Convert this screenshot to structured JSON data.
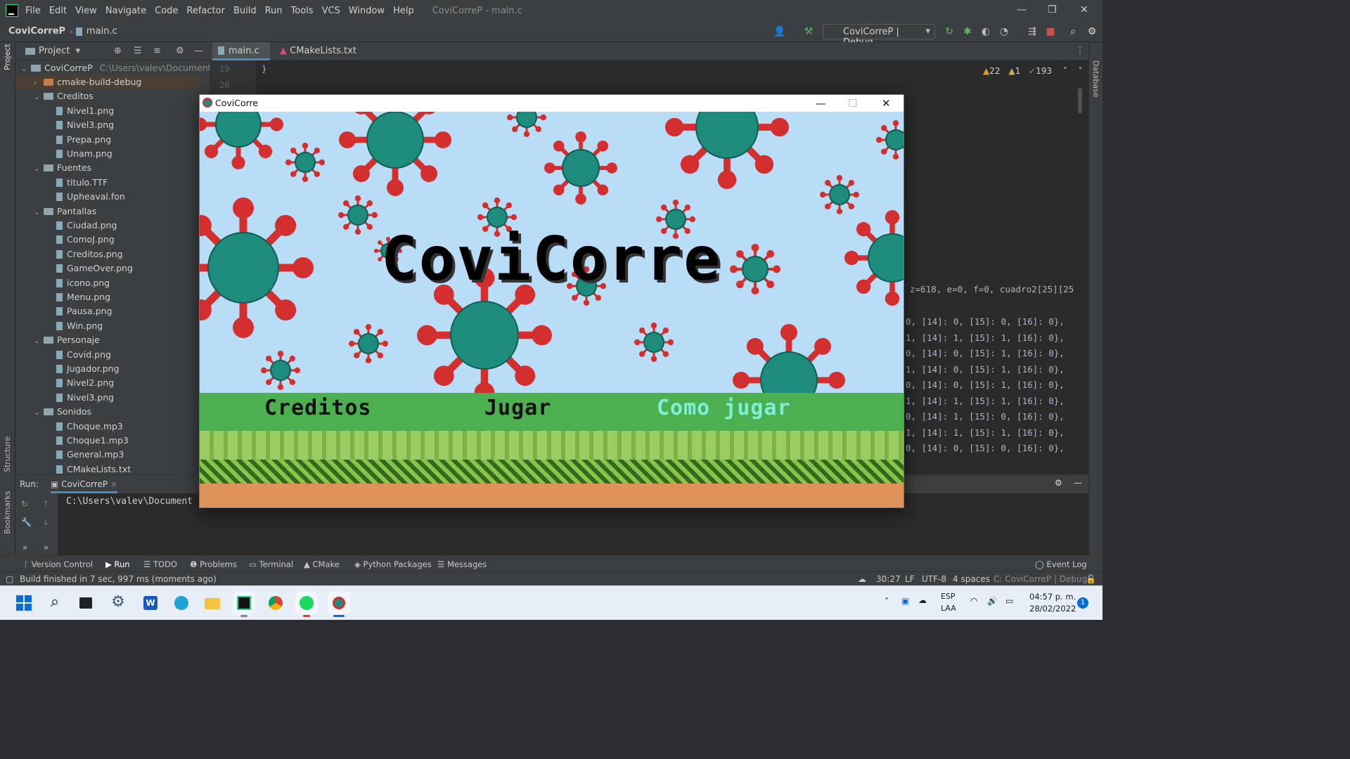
{
  "ide": {
    "app_name": "CLion",
    "menu": [
      "File",
      "Edit",
      "View",
      "Navigate",
      "Code",
      "Refactor",
      "Build",
      "Run",
      "Tools",
      "VCS",
      "Window",
      "Help"
    ],
    "window_title": "CoviCorreP - main.c",
    "breadcrumb": {
      "project": "CoviCorreP",
      "file": "main.c"
    },
    "run_config": "CoviCorreP | Debug",
    "inspections": {
      "warnings": "22",
      "weak_warnings": "1",
      "ok": "193"
    },
    "right_strip_label": "Database",
    "left_strip_labels": [
      "Project",
      "Structure",
      "Bookmarks"
    ]
  },
  "project_panel": {
    "title": "Project",
    "root": {
      "name": "CoviCorreP",
      "path": "C:\\Users\\valev\\Documents\\Pr"
    },
    "items": [
      {
        "label": "cmake-build-debug",
        "kind": "folder-orange",
        "depth": 1,
        "arrow": "›"
      },
      {
        "label": "Creditos",
        "kind": "folder",
        "depth": 1,
        "arrow": "⌄"
      },
      {
        "label": "Nivel1.png",
        "kind": "file",
        "depth": 2
      },
      {
        "label": "Nivel3.png",
        "kind": "file",
        "depth": 2
      },
      {
        "label": "Prepa.png",
        "kind": "file",
        "depth": 2
      },
      {
        "label": "Unam.png",
        "kind": "file",
        "depth": 2
      },
      {
        "label": "Fuentes",
        "kind": "folder",
        "depth": 1,
        "arrow": "⌄"
      },
      {
        "label": "titulo.TTF",
        "kind": "file",
        "depth": 2
      },
      {
        "label": "Upheaval.fon",
        "kind": "file",
        "depth": 2
      },
      {
        "label": "Pantallas",
        "kind": "folder",
        "depth": 1,
        "arrow": "⌄"
      },
      {
        "label": "Ciudad.png",
        "kind": "file",
        "depth": 2
      },
      {
        "label": "ComoJ.png",
        "kind": "file",
        "depth": 2
      },
      {
        "label": "Creditos.png",
        "kind": "file",
        "depth": 2
      },
      {
        "label": "GameOver.png",
        "kind": "file",
        "depth": 2
      },
      {
        "label": "icono.png",
        "kind": "file",
        "depth": 2
      },
      {
        "label": "Menu.png",
        "kind": "file",
        "depth": 2
      },
      {
        "label": "Pausa.png",
        "kind": "file",
        "depth": 2
      },
      {
        "label": "Win.png",
        "kind": "file",
        "depth": 2
      },
      {
        "label": "Personaje",
        "kind": "folder",
        "depth": 1,
        "arrow": "⌄"
      },
      {
        "label": "Covid.png",
        "kind": "file",
        "depth": 2
      },
      {
        "label": "Jugador.png",
        "kind": "file",
        "depth": 2
      },
      {
        "label": "Nivel2.png",
        "kind": "file",
        "depth": 2
      },
      {
        "label": "Nivel3.png",
        "kind": "file",
        "depth": 2
      },
      {
        "label": "Sonidos",
        "kind": "folder",
        "depth": 1,
        "arrow": "⌄"
      },
      {
        "label": "Choque.mp3",
        "kind": "file",
        "depth": 2
      },
      {
        "label": "Choque1.mp3",
        "kind": "file",
        "depth": 2
      },
      {
        "label": "General.mp3",
        "kind": "file",
        "depth": 2
      },
      {
        "label": "CMakeLists.txt",
        "kind": "file",
        "depth": 2
      }
    ]
  },
  "editor": {
    "tabs": [
      "main.c",
      "CMakeLists.txt"
    ],
    "line_numbers": [
      "19",
      "20"
    ],
    "first_line_code": "}",
    "code_decl": "z=618, e=0, f=0, cuadro2[25][25",
    "rows": [
      "0, [14]: 0, [15]: 0, [16]: 0},",
      "1, [14]: 1, [15]: 1, [16]: 0},",
      "0, [14]: 0, [15]: 1, [16]: 0},",
      "1, [14]: 0, [15]: 1, [16]: 0},",
      "0, [14]: 0, [15]: 1, [16]: 0},",
      "1, [14]: 1, [15]: 1, [16]: 0},",
      "0, [14]: 1, [15]: 0, [16]: 0},",
      "1, [14]: 1, [15]: 1, [16]: 0},",
      "0, [14]: 0, [15]: 0, [16]: 0},"
    ]
  },
  "run_panel": {
    "label": "Run:",
    "tab": "CoviCorreP",
    "output": "C:\\Users\\valev\\Document"
  },
  "bottom_tools": [
    "Version Control",
    "Run",
    "TODO",
    "Problems",
    "Terminal",
    "CMake",
    "Python Packages",
    "Messages"
  ],
  "event_log": "Event Log",
  "status": {
    "message": "Build finished in 7 sec, 997 ms (moments ago)",
    "position": "30:27",
    "line_sep": "LF",
    "encoding": "UTF-8",
    "indent": "4 spaces",
    "context": "C: CoviCorreP | Debug"
  },
  "game_window": {
    "title": "CoviCorre",
    "big_title": "CoviCorre",
    "menu": {
      "creditos": "Creditos",
      "jugar": "Jugar",
      "como_jugar": "Como jugar"
    },
    "colors": {
      "sky": "#b9dcf7",
      "virus_body": "#1e8c7d",
      "virus_spike": "#d32f2f",
      "selected": "#7ff0d8"
    }
  },
  "taskbar": {
    "lang": "ESP",
    "layout": "LAA",
    "time": "04:57 p. m.",
    "date": "28/02/2022",
    "notif_count": "1"
  }
}
